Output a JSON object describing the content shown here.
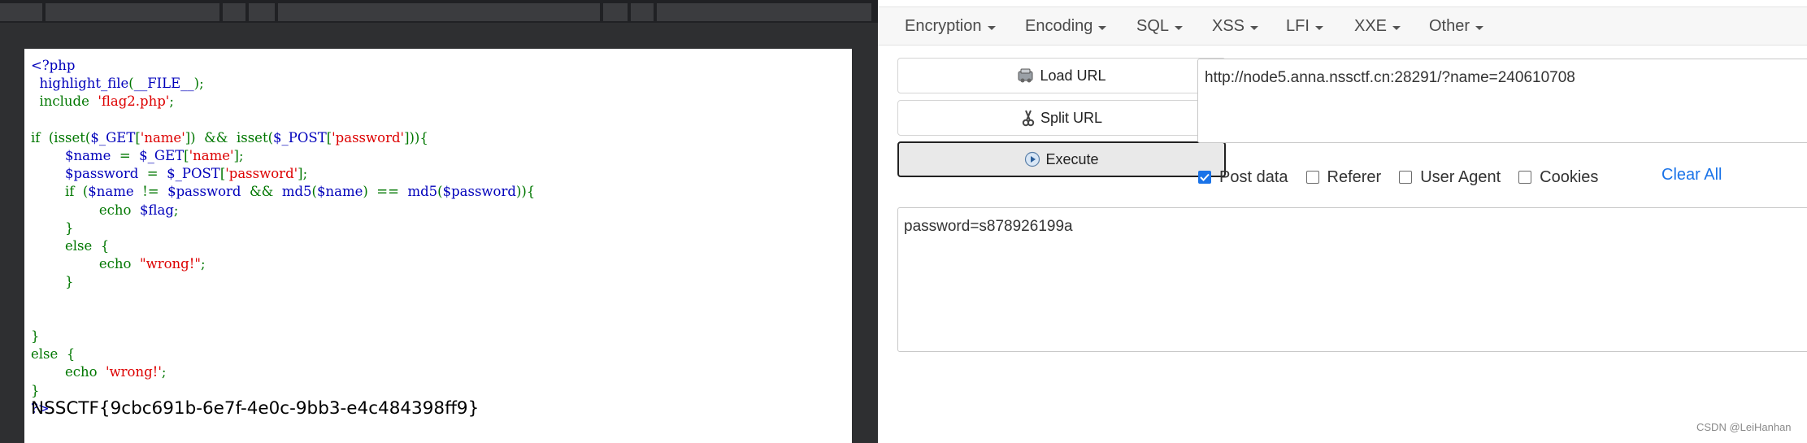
{
  "code": {
    "lines": [
      [
        [
          "d",
          "<?php"
        ]
      ],
      [
        [
          "d",
          "  highlight_file"
        ],
        [
          "k",
          "("
        ],
        [
          "d",
          "__FILE__"
        ],
        [
          "k",
          ");"
        ]
      ],
      [
        [
          "k",
          "  include  "
        ],
        [
          "s",
          "'flag2.php'"
        ],
        [
          "k",
          ";"
        ]
      ],
      [],
      [
        [
          "k",
          "if  (isset("
        ],
        [
          "d",
          "$_GET"
        ],
        [
          "k",
          "["
        ],
        [
          "s",
          "'name'"
        ],
        [
          "k",
          "])  &&  isset("
        ],
        [
          "d",
          "$_POST"
        ],
        [
          "k",
          "["
        ],
        [
          "s",
          "'password'"
        ],
        [
          "k",
          "])){"
        ]
      ],
      [
        [
          "d",
          "        $name  "
        ],
        [
          "k",
          "=  "
        ],
        [
          "d",
          "$_GET"
        ],
        [
          "k",
          "["
        ],
        [
          "s",
          "'name'"
        ],
        [
          "k",
          "];"
        ]
      ],
      [
        [
          "d",
          "        $password  "
        ],
        [
          "k",
          "=  "
        ],
        [
          "d",
          "$_POST"
        ],
        [
          "k",
          "["
        ],
        [
          "s",
          "'password'"
        ],
        [
          "k",
          "];"
        ]
      ],
      [
        [
          "k",
          "        if  ("
        ],
        [
          "d",
          "$name  "
        ],
        [
          "k",
          "!=  "
        ],
        [
          "d",
          "$password  "
        ],
        [
          "k",
          "&&  "
        ],
        [
          "d",
          "md5"
        ],
        [
          "k",
          "("
        ],
        [
          "d",
          "$name"
        ],
        [
          "k",
          ")  ==  "
        ],
        [
          "d",
          "md5"
        ],
        [
          "k",
          "("
        ],
        [
          "d",
          "$password"
        ],
        [
          "k",
          ")){"
        ]
      ],
      [
        [
          "k",
          "                echo  "
        ],
        [
          "d",
          "$flag"
        ],
        [
          "k",
          ";"
        ]
      ],
      [
        [
          "k",
          "        }"
        ]
      ],
      [
        [
          "k",
          "        else  {"
        ]
      ],
      [
        [
          "k",
          "                echo  "
        ],
        [
          "s",
          "\"wrong!\""
        ],
        [
          "k",
          ";"
        ]
      ],
      [
        [
          "k",
          "        }"
        ]
      ],
      [],
      [],
      [
        [
          "k",
          "}"
        ]
      ],
      [
        [
          "k",
          "else  {"
        ]
      ],
      [
        [
          "k",
          "        echo  "
        ],
        [
          "s",
          "'wrong!'"
        ],
        [
          "k",
          ";"
        ]
      ],
      [
        [
          "k",
          "}"
        ]
      ],
      [
        [
          "d",
          "?>"
        ]
      ]
    ],
    "flag": "NSSCTF{9cbc691b-6e7f-4e0c-9bb3-e4c484398ff9}"
  },
  "hackbar": {
    "menu": [
      "Encryption",
      "Encoding",
      "SQL",
      "XSS",
      "LFI",
      "XXE",
      "Other"
    ],
    "buttons": {
      "load_url": "Load URL",
      "split_url": "Split URL",
      "execute": "Execute"
    },
    "url_value": "http://node5.anna.nssctf.cn:28291/?name=240610708",
    "options": {
      "post_data": "Post data",
      "referer": "Referer",
      "user_agent": "User Agent",
      "cookies": "Cookies"
    },
    "checked": {
      "post_data": true,
      "referer": false,
      "user_agent": false,
      "cookies": false
    },
    "clear_all": "Clear All",
    "post_value": "password=s878926199a"
  },
  "watermark": "CSDN @LeiHanhan",
  "colors": {
    "keyword": "#007700",
    "default": "#0000bb",
    "string": "#dd0000",
    "link": "#1a73e8"
  }
}
